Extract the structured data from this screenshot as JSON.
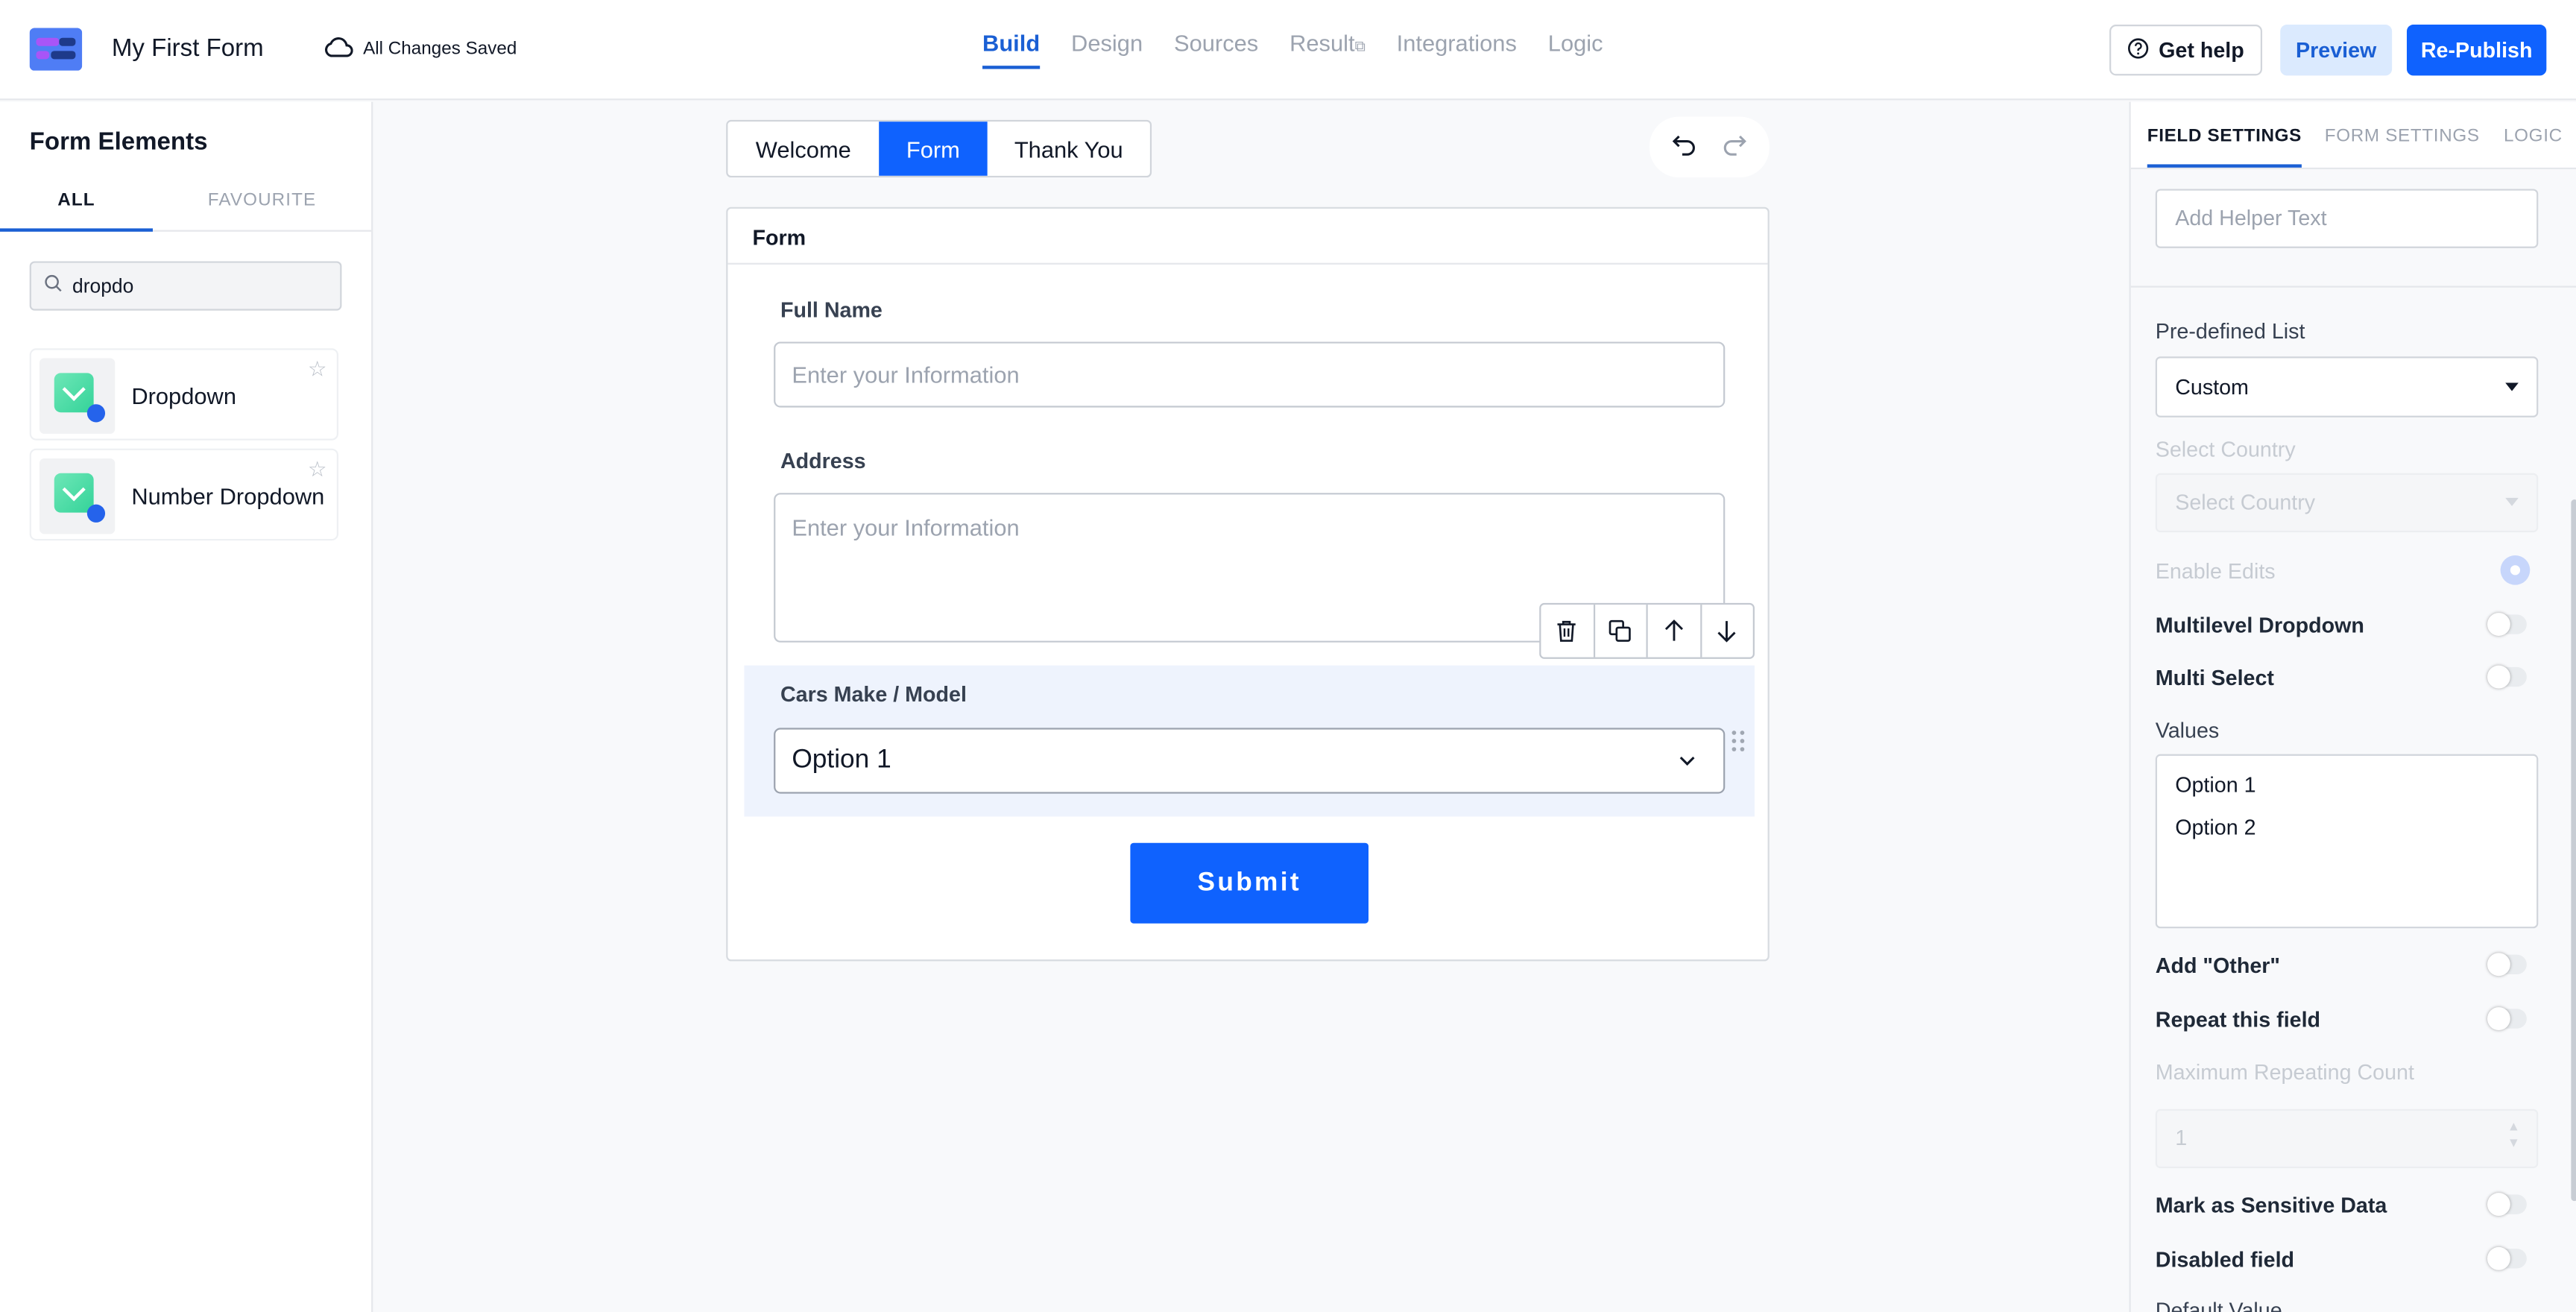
{
  "header": {
    "form_name": "My First Form",
    "save_status": "All Changes Saved",
    "nav": [
      {
        "label": "Build",
        "active": true
      },
      {
        "label": "Design"
      },
      {
        "label": "Sources"
      },
      {
        "label": "Result",
        "external": true
      },
      {
        "label": "Integrations"
      },
      {
        "label": "Logic"
      }
    ],
    "help_label": "Get help",
    "preview_label": "Preview",
    "publish_label": "Re-Publish"
  },
  "sidebar": {
    "title": "Form Elements",
    "tabs": [
      "ALL",
      "FAVOURITE"
    ],
    "search_value": "dropdo",
    "elements": [
      {
        "label": "Dropdown",
        "icon": "dropdown-icon"
      },
      {
        "label": "Number Dropdown",
        "icon": "dropdown-icon"
      }
    ]
  },
  "canvas": {
    "tabs": [
      {
        "label": "Welcome"
      },
      {
        "label": "Form",
        "active": true
      },
      {
        "label": "Thank You"
      }
    ],
    "form_title": "Form",
    "fields": [
      {
        "label": "Full Name",
        "placeholder": "Enter your Information"
      },
      {
        "label": "Address",
        "placeholder": "Enter your Information"
      },
      {
        "label": "Cars Make / Model",
        "value": "Option 1"
      }
    ],
    "submit_label": "Submit"
  },
  "settings": {
    "tabs": [
      "FIELD SETTINGS",
      "FORM SETTINGS",
      "LOGIC"
    ],
    "helper_placeholder": "Add Helper Text",
    "predefined_label": "Pre-defined List",
    "predefined_value": "Custom",
    "country_label": "Select Country",
    "country_placeholder": "Select Country",
    "enable_edits": "Enable Edits",
    "multilevel": "Multilevel Dropdown",
    "multiselect": "Multi Select",
    "values_label": "Values",
    "values": [
      "Option 1",
      "Option 2"
    ],
    "add_other": "Add \"Other\"",
    "repeat": "Repeat this field",
    "max_repeat_label": "Maximum Repeating Count",
    "max_repeat_value": "1",
    "sensitive": "Mark as Sensitive Data",
    "disabled": "Disabled field",
    "default_value": "Default Value"
  },
  "colors": {
    "primary": "#0f62fe",
    "selected_bg": "#eef3fd"
  }
}
